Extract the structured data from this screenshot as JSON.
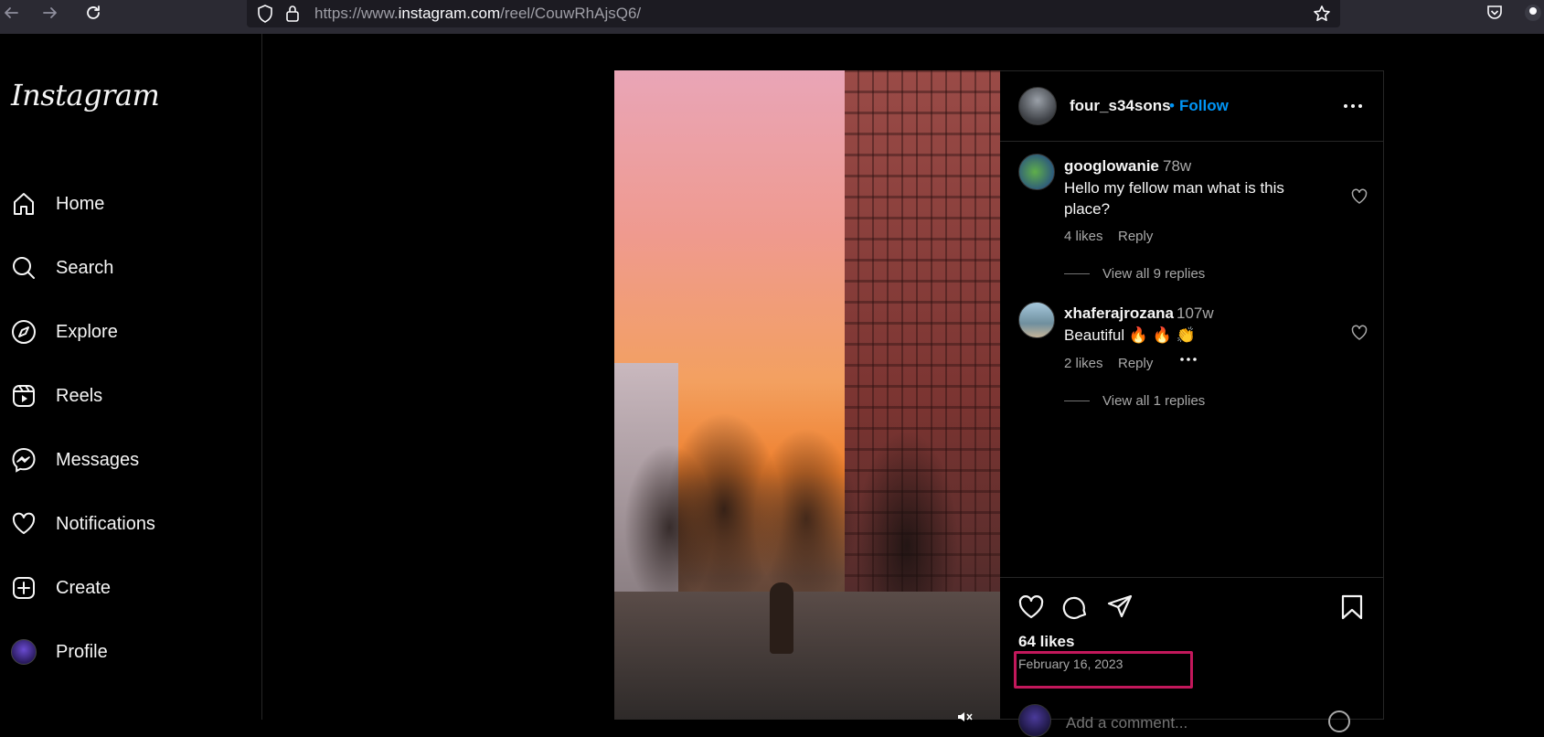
{
  "browser": {
    "url_prefix": "https://www.",
    "url_host": "instagram.com",
    "url_path": "/reel/CouwRhAjsQ6/"
  },
  "sidebar": {
    "logo": "Instagram",
    "items": [
      {
        "label": "Home",
        "icon": "home-icon"
      },
      {
        "label": "Search",
        "icon": "search-icon"
      },
      {
        "label": "Explore",
        "icon": "compass-icon"
      },
      {
        "label": "Reels",
        "icon": "reels-icon"
      },
      {
        "label": "Messages",
        "icon": "messenger-icon"
      },
      {
        "label": "Notifications",
        "icon": "heart-icon"
      },
      {
        "label": "Create",
        "icon": "plus-square-icon"
      },
      {
        "label": "Profile",
        "icon": "avatar"
      }
    ]
  },
  "post": {
    "username": "four_s34sons",
    "separator": "•",
    "follow_label": "Follow",
    "likes": "64 likes",
    "date": "February 16, 2023",
    "add_comment_placeholder": "Add a comment..."
  },
  "comments": [
    {
      "username": "googlowanie",
      "time": "78w",
      "text_line1": "Hello my fellow man what is this",
      "text_line2": "place?",
      "likes": "4 likes",
      "reply": "Reply",
      "view_replies": "View all 9 replies"
    },
    {
      "username": "xhaferajrozana",
      "time": "107w",
      "text": "Beautiful 🔥 🔥 👏",
      "likes": "2 likes",
      "reply": "Reply",
      "view_replies": "View all 1 replies"
    }
  ],
  "colors": {
    "accent_blue": "#0095f6",
    "highlight_box": "#c2185b"
  }
}
